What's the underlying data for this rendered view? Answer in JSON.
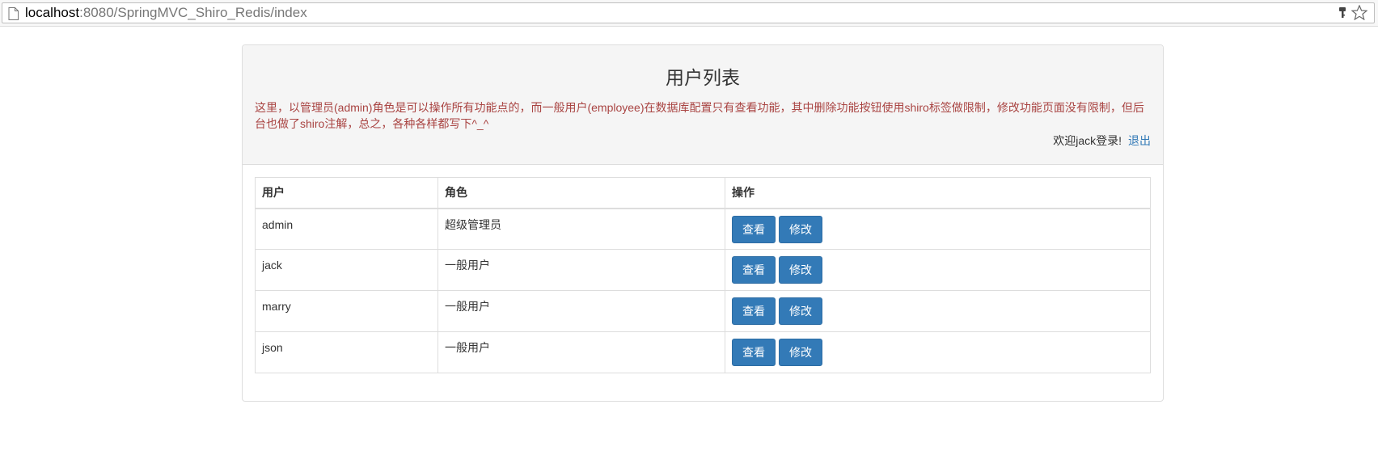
{
  "browser": {
    "url_host": "localhost",
    "url_rest": ":8080/SpringMVC_Shiro_Redis/index"
  },
  "panel": {
    "title": "用户列表",
    "notice": "这里，以管理员(admin)角色是可以操作所有功能点的，而一般用户(employee)在数据库配置只有查看功能，其中删除功能按钮使用shiro标签做限制，修改功能页面没有限制，但后台也做了shiro注解，总之，各种各样都写下^_^",
    "welcome": "欢迎jack登录!",
    "logout": "退出"
  },
  "table": {
    "headers": [
      "用户",
      "角色",
      "操作"
    ],
    "rows": [
      {
        "user": "admin",
        "role": "超级管理员",
        "view": "查看",
        "edit": "修改"
      },
      {
        "user": "jack",
        "role": "一般用户",
        "view": "查看",
        "edit": "修改"
      },
      {
        "user": "marry",
        "role": "一般用户",
        "view": "查看",
        "edit": "修改"
      },
      {
        "user": "json",
        "role": "一般用户",
        "view": "查看",
        "edit": "修改"
      }
    ]
  },
  "colors": {
    "button": "#337ab7",
    "notice": "#a94442",
    "link": "#337ab7"
  },
  "icons": [
    "page-icon",
    "key-icon",
    "star-icon"
  ]
}
